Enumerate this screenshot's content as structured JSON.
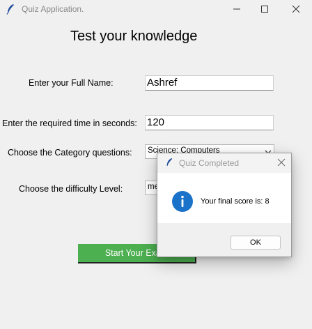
{
  "window": {
    "title": "Quiz Application.",
    "icon": "feather-icon"
  },
  "form": {
    "heading": "Test your knowledge",
    "name_label": "Enter your Full Name:",
    "name_value": "Ashref",
    "time_label": "Enter the required time in seconds:",
    "time_value": "120",
    "category_label": "Choose the Category questions:",
    "category_value": "Science: Computers",
    "difficulty_label": "Choose the difficulty Level:",
    "difficulty_value": "medium",
    "start_button": "Start Your Exam",
    "start_button_color": "#4caf50"
  },
  "dialog": {
    "title": "Quiz Completed",
    "message": "Your final score is: 8",
    "ok_label": "OK",
    "icon": "info-icon",
    "icon_color": "#1a73c9"
  }
}
